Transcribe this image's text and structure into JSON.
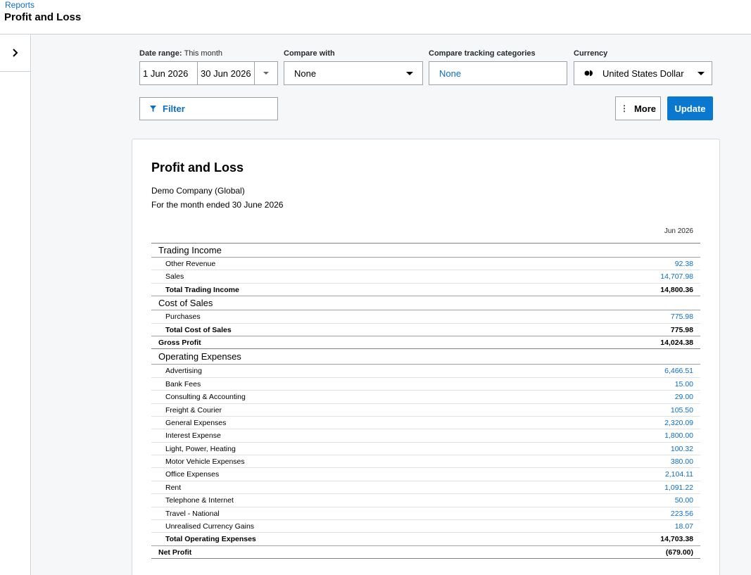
{
  "header": {
    "breadcrumb": "Reports",
    "title": "Profit and Loss"
  },
  "filters": {
    "date_range_label": "Date range:",
    "date_range_preset": "This month",
    "date_from": "1 Jun 2026",
    "date_to": "30 Jun 2026",
    "compare_with_label": "Compare with",
    "compare_with_value": "None",
    "tracking_label": "Compare tracking categories",
    "tracking_value": "None",
    "currency_label": "Currency",
    "currency_value": "United States Dollar",
    "filter_button": "Filter",
    "more_button": "More",
    "update_button": "Update"
  },
  "report": {
    "title": "Profit and Loss",
    "company": "Demo Company (Global)",
    "period": "For the month ended 30 June 2026",
    "column": "Jun 2026",
    "trading_income": {
      "heading": "Trading Income",
      "rows": [
        {
          "name": "Other Revenue",
          "value": "92.38"
        },
        {
          "name": "Sales",
          "value": "14,707.98"
        }
      ],
      "total_name": "Total Trading Income",
      "total_value": "14,800.36"
    },
    "cost_of_sales": {
      "heading": "Cost of Sales",
      "rows": [
        {
          "name": "Purchases",
          "value": "775.98"
        }
      ],
      "total_name": "Total Cost of Sales",
      "total_value": "775.98"
    },
    "gross_profit": {
      "name": "Gross Profit",
      "value": "14,024.38"
    },
    "operating_expenses": {
      "heading": "Operating Expenses",
      "rows": [
        {
          "name": "Advertising",
          "value": "6,466.51"
        },
        {
          "name": "Bank Fees",
          "value": "15.00"
        },
        {
          "name": "Consulting & Accounting",
          "value": "29.00"
        },
        {
          "name": "Freight & Courier",
          "value": "105.50"
        },
        {
          "name": "General Expenses",
          "value": "2,320.09"
        },
        {
          "name": "Interest Expense",
          "value": "1,800.00"
        },
        {
          "name": "Light, Power, Heating",
          "value": "100.32"
        },
        {
          "name": "Motor Vehicle Expenses",
          "value": "380.00"
        },
        {
          "name": "Office Expenses",
          "value": "2,104.11"
        },
        {
          "name": "Rent",
          "value": "1,091.22"
        },
        {
          "name": "Telephone & Internet",
          "value": "50.00"
        },
        {
          "name": "Travel - National",
          "value": "223.56"
        },
        {
          "name": "Unrealised Currency Gains",
          "value": "18.07"
        }
      ],
      "total_name": "Total Operating Expenses",
      "total_value": "14,703.38"
    },
    "net_profit": {
      "name": "Net Profit",
      "value": "(679.00)"
    }
  },
  "colors": {
    "accent": "#0b6ec2",
    "update_button": "#0b78d0"
  }
}
